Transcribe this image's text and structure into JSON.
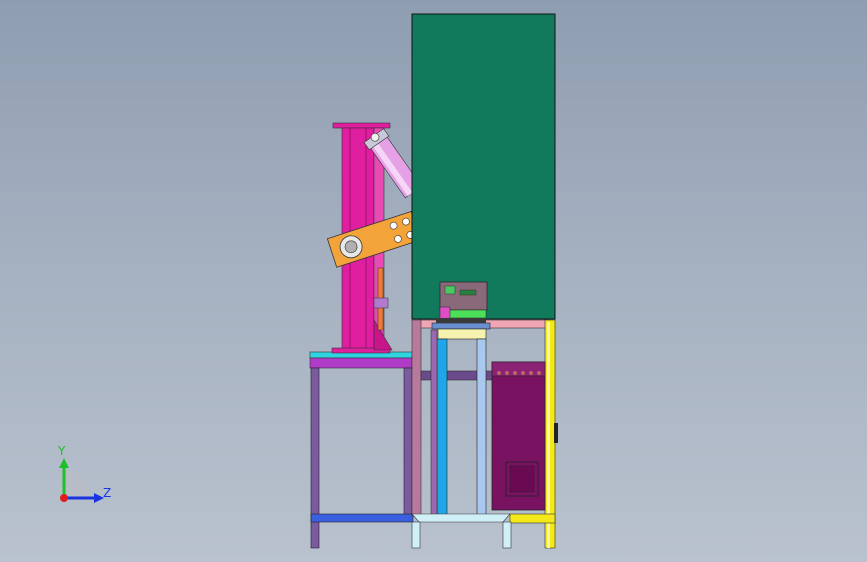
{
  "triad": {
    "y_label": "Y",
    "z_label": "Z",
    "y_color": "#1fbf2a",
    "z_color": "#1c34e0",
    "x_color": "#e01c1c"
  },
  "colors": {
    "cabinet": "#127a5c",
    "column": "#e01fa0",
    "arm": "#f2a33a",
    "table_frame": "#7b5aa0",
    "bench_top": "#b03bc8",
    "cyan_leg": "#1ea6e6",
    "light_leg": "#a8c8f0",
    "control_box": "#7a1262",
    "yellow_post": "#f2e81a",
    "blue_rail": "#3a5fe0",
    "pink_rail": "#f0a6b4"
  }
}
